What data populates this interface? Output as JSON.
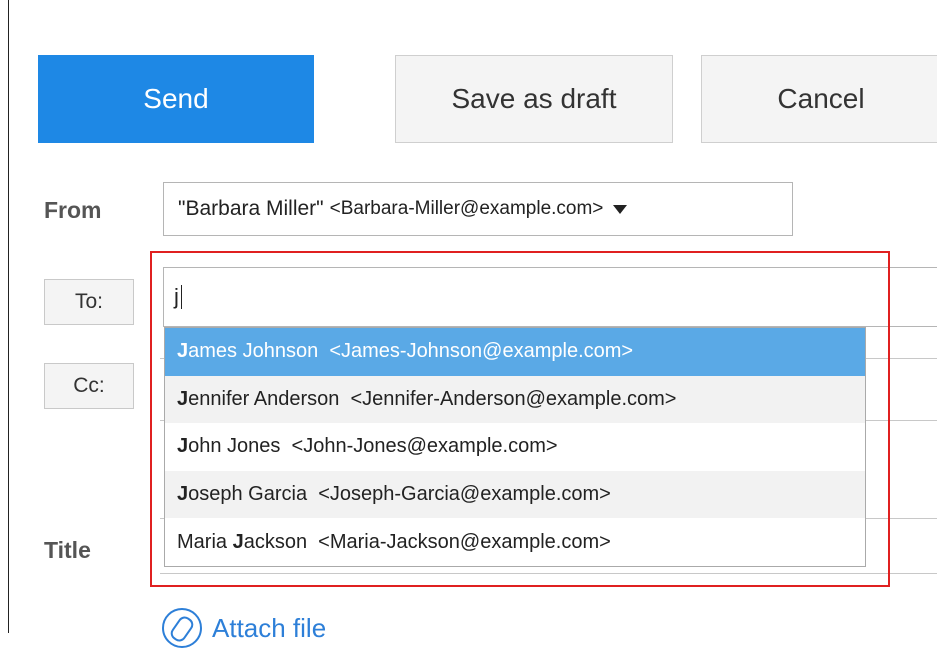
{
  "toolbar": {
    "send_label": "Send",
    "save_draft_label": "Save as draft",
    "cancel_label": "Cancel"
  },
  "from": {
    "label": "From",
    "name": "\"Barbara Miller\"",
    "email": "<Barbara-Miller@example.com>"
  },
  "to": {
    "button_label": "To:",
    "input_value": "j"
  },
  "cc": {
    "button_label": "Cc:"
  },
  "title": {
    "label": "Title"
  },
  "suggestions": {
    "items": [
      {
        "pre": "",
        "match": "J",
        "rest": "ames Johnson  <James-Johnson@example.com>"
      },
      {
        "pre": "",
        "match": "J",
        "rest": "ennifer Anderson  <Jennifer-Anderson@example.com>"
      },
      {
        "pre": "",
        "match": "J",
        "rest": "ohn Jones  <John-Jones@example.com>"
      },
      {
        "pre": "",
        "match": "J",
        "rest": "oseph Garcia  <Joseph-Garcia@example.com>"
      },
      {
        "pre": "Maria ",
        "match": "J",
        "rest": "ackson  <Maria-Jackson@example.com>"
      }
    ]
  },
  "attach": {
    "label": "Attach file"
  },
  "colors": {
    "primary": "#1e88e5",
    "selected_row": "#5aa9e6",
    "highlight_box": "#e02020",
    "link": "#2d7fd8"
  }
}
